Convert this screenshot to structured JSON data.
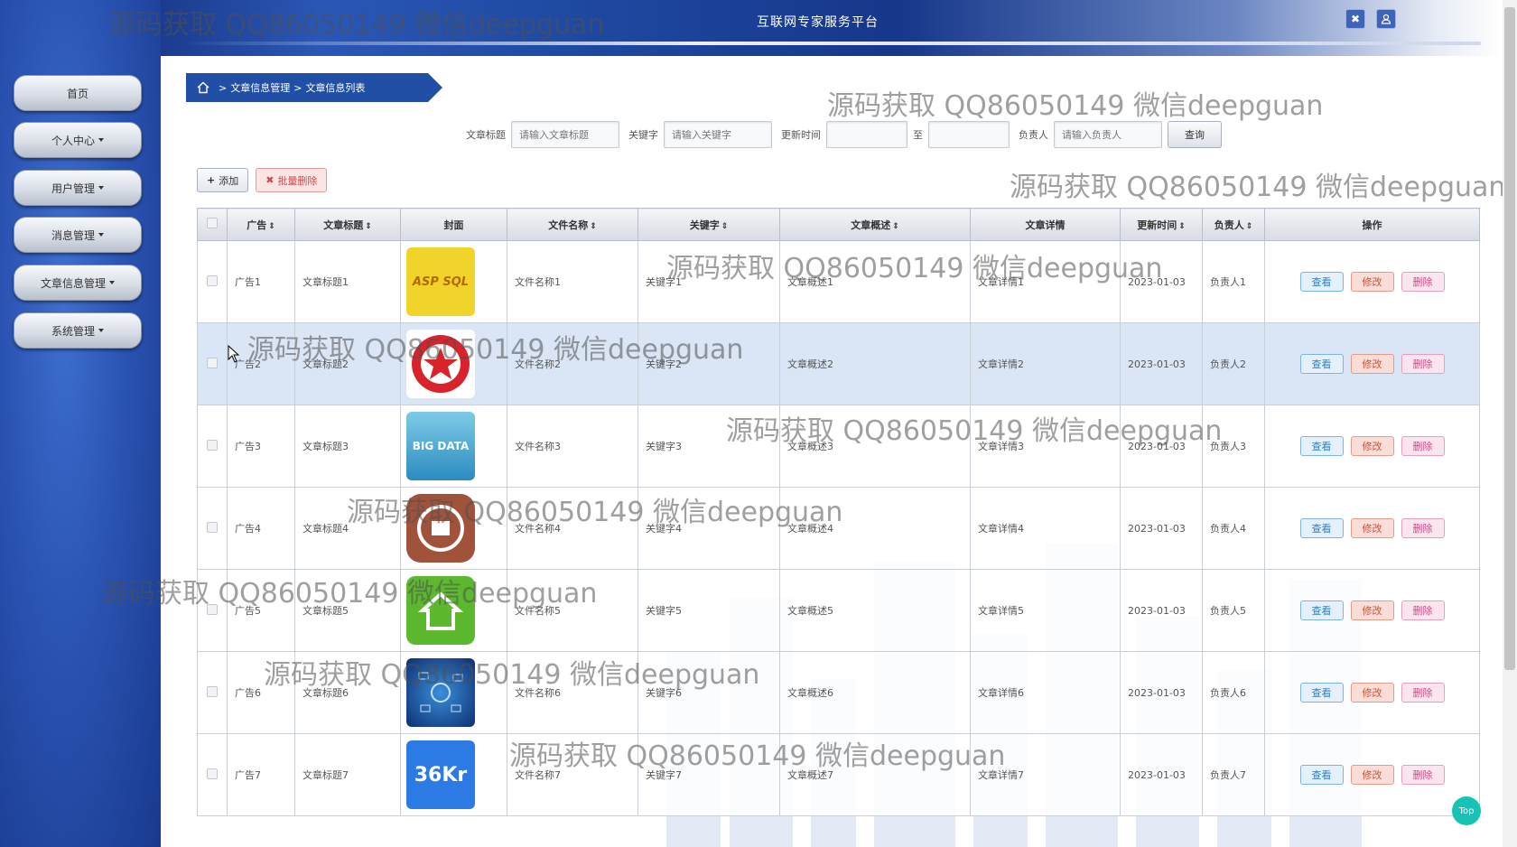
{
  "app": {
    "title": "互联网专家服务平台"
  },
  "watermark_text": "源码获取 QQ86050149 微信deepguan",
  "sidebar": {
    "items": [
      {
        "label": "首页",
        "has_caret": false
      },
      {
        "label": "个人中心",
        "has_caret": true
      },
      {
        "label": "用户管理",
        "has_caret": true
      },
      {
        "label": "消息管理",
        "has_caret": true
      },
      {
        "label": "文章信息管理",
        "has_caret": true
      },
      {
        "label": "系统管理",
        "has_caret": true
      }
    ]
  },
  "breadcrumb": {
    "level1": "文章信息管理",
    "level2": "文章信息列表",
    "sep": ">"
  },
  "search": {
    "title_label": "文章标题",
    "title_placeholder": "请输入文章标题",
    "keyword_label": "关键字",
    "keyword_placeholder": "请输入关键字",
    "time_label": "更新时间",
    "time_to": "至",
    "owner_label": "负责人",
    "owner_placeholder": "请输入负责人",
    "query_label": "查询"
  },
  "toolbar": {
    "add_label": "添加",
    "batch_delete_label": "批量删除"
  },
  "table": {
    "columns": [
      "广告",
      "文章标题",
      "封面",
      "文件名称",
      "关键字",
      "文章概述",
      "文章详情",
      "更新时间",
      "负责人",
      "操作"
    ],
    "rows": [
      {
        "ad": "广告1",
        "title": "文章标题1",
        "file": "文件名称1",
        "keyword": "关键字1",
        "summary": "文章概述1",
        "detail": "文章详情1",
        "time": "2023-01-03",
        "owner": "负责人1",
        "cover": "ASP SQL"
      },
      {
        "ad": "广告2",
        "title": "文章标题2",
        "file": "文件名称2",
        "keyword": "关键字2",
        "summary": "文章概述2",
        "detail": "文章详情2",
        "time": "2023-01-03",
        "owner": "负责人2",
        "cover": ""
      },
      {
        "ad": "广告3",
        "title": "文章标题3",
        "file": "文件名称3",
        "keyword": "关键字3",
        "summary": "文章概述3",
        "detail": "文章详情3",
        "time": "2023-01-03",
        "owner": "负责人3",
        "cover": "BIG DATA"
      },
      {
        "ad": "广告4",
        "title": "文章标题4",
        "file": "文件名称4",
        "keyword": "关键字4",
        "summary": "文章概述4",
        "detail": "文章详情4",
        "time": "2023-01-03",
        "owner": "负责人4",
        "cover": ""
      },
      {
        "ad": "广告5",
        "title": "文章标题5",
        "file": "文件名称5",
        "keyword": "关键字5",
        "summary": "文章概述5",
        "detail": "文章详情5",
        "time": "2023-01-03",
        "owner": "负责人5",
        "cover": ""
      },
      {
        "ad": "广告6",
        "title": "文章标题6",
        "file": "文件名称6",
        "keyword": "关键字6",
        "summary": "文章概述6",
        "detail": "文章详情6",
        "time": "2023-01-03",
        "owner": "负责人6",
        "cover": ""
      },
      {
        "ad": "广告7",
        "title": "文章标题7",
        "file": "文件名称7",
        "keyword": "关键字7",
        "summary": "文章概述7",
        "detail": "文章详情7",
        "time": "2023-01-03",
        "owner": "负责人7",
        "cover": "36Kr"
      }
    ],
    "actions": {
      "view": "查看",
      "edit": "修改",
      "delete": "删除"
    }
  },
  "top_button": "Top",
  "colors": {
    "brand_blue": "#214fa6",
    "sidebar_blue": "#2a53b2",
    "top_button": "#17c3b4"
  }
}
